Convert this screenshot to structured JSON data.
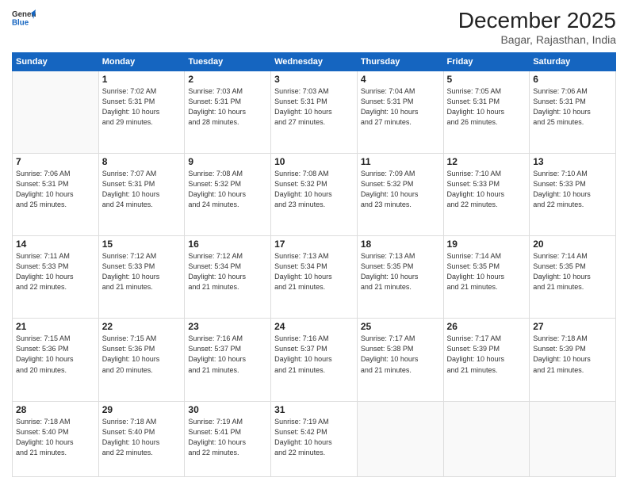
{
  "logo": {
    "line1": "General",
    "line2": "Blue"
  },
  "header": {
    "title": "December 2025",
    "subtitle": "Bagar, Rajasthan, India"
  },
  "days_of_week": [
    "Sunday",
    "Monday",
    "Tuesday",
    "Wednesday",
    "Thursday",
    "Friday",
    "Saturday"
  ],
  "weeks": [
    [
      {
        "day": "",
        "info": ""
      },
      {
        "day": "1",
        "info": "Sunrise: 7:02 AM\nSunset: 5:31 PM\nDaylight: 10 hours\nand 29 minutes."
      },
      {
        "day": "2",
        "info": "Sunrise: 7:03 AM\nSunset: 5:31 PM\nDaylight: 10 hours\nand 28 minutes."
      },
      {
        "day": "3",
        "info": "Sunrise: 7:03 AM\nSunset: 5:31 PM\nDaylight: 10 hours\nand 27 minutes."
      },
      {
        "day": "4",
        "info": "Sunrise: 7:04 AM\nSunset: 5:31 PM\nDaylight: 10 hours\nand 27 minutes."
      },
      {
        "day": "5",
        "info": "Sunrise: 7:05 AM\nSunset: 5:31 PM\nDaylight: 10 hours\nand 26 minutes."
      },
      {
        "day": "6",
        "info": "Sunrise: 7:06 AM\nSunset: 5:31 PM\nDaylight: 10 hours\nand 25 minutes."
      }
    ],
    [
      {
        "day": "7",
        "info": "Sunrise: 7:06 AM\nSunset: 5:31 PM\nDaylight: 10 hours\nand 25 minutes."
      },
      {
        "day": "8",
        "info": "Sunrise: 7:07 AM\nSunset: 5:31 PM\nDaylight: 10 hours\nand 24 minutes."
      },
      {
        "day": "9",
        "info": "Sunrise: 7:08 AM\nSunset: 5:32 PM\nDaylight: 10 hours\nand 24 minutes."
      },
      {
        "day": "10",
        "info": "Sunrise: 7:08 AM\nSunset: 5:32 PM\nDaylight: 10 hours\nand 23 minutes."
      },
      {
        "day": "11",
        "info": "Sunrise: 7:09 AM\nSunset: 5:32 PM\nDaylight: 10 hours\nand 23 minutes."
      },
      {
        "day": "12",
        "info": "Sunrise: 7:10 AM\nSunset: 5:33 PM\nDaylight: 10 hours\nand 22 minutes."
      },
      {
        "day": "13",
        "info": "Sunrise: 7:10 AM\nSunset: 5:33 PM\nDaylight: 10 hours\nand 22 minutes."
      }
    ],
    [
      {
        "day": "14",
        "info": "Sunrise: 7:11 AM\nSunset: 5:33 PM\nDaylight: 10 hours\nand 22 minutes."
      },
      {
        "day": "15",
        "info": "Sunrise: 7:12 AM\nSunset: 5:33 PM\nDaylight: 10 hours\nand 21 minutes."
      },
      {
        "day": "16",
        "info": "Sunrise: 7:12 AM\nSunset: 5:34 PM\nDaylight: 10 hours\nand 21 minutes."
      },
      {
        "day": "17",
        "info": "Sunrise: 7:13 AM\nSunset: 5:34 PM\nDaylight: 10 hours\nand 21 minutes."
      },
      {
        "day": "18",
        "info": "Sunrise: 7:13 AM\nSunset: 5:35 PM\nDaylight: 10 hours\nand 21 minutes."
      },
      {
        "day": "19",
        "info": "Sunrise: 7:14 AM\nSunset: 5:35 PM\nDaylight: 10 hours\nand 21 minutes."
      },
      {
        "day": "20",
        "info": "Sunrise: 7:14 AM\nSunset: 5:35 PM\nDaylight: 10 hours\nand 21 minutes."
      }
    ],
    [
      {
        "day": "21",
        "info": "Sunrise: 7:15 AM\nSunset: 5:36 PM\nDaylight: 10 hours\nand 20 minutes."
      },
      {
        "day": "22",
        "info": "Sunrise: 7:15 AM\nSunset: 5:36 PM\nDaylight: 10 hours\nand 20 minutes."
      },
      {
        "day": "23",
        "info": "Sunrise: 7:16 AM\nSunset: 5:37 PM\nDaylight: 10 hours\nand 21 minutes."
      },
      {
        "day": "24",
        "info": "Sunrise: 7:16 AM\nSunset: 5:37 PM\nDaylight: 10 hours\nand 21 minutes."
      },
      {
        "day": "25",
        "info": "Sunrise: 7:17 AM\nSunset: 5:38 PM\nDaylight: 10 hours\nand 21 minutes."
      },
      {
        "day": "26",
        "info": "Sunrise: 7:17 AM\nSunset: 5:39 PM\nDaylight: 10 hours\nand 21 minutes."
      },
      {
        "day": "27",
        "info": "Sunrise: 7:18 AM\nSunset: 5:39 PM\nDaylight: 10 hours\nand 21 minutes."
      }
    ],
    [
      {
        "day": "28",
        "info": "Sunrise: 7:18 AM\nSunset: 5:40 PM\nDaylight: 10 hours\nand 21 minutes."
      },
      {
        "day": "29",
        "info": "Sunrise: 7:18 AM\nSunset: 5:40 PM\nDaylight: 10 hours\nand 22 minutes."
      },
      {
        "day": "30",
        "info": "Sunrise: 7:19 AM\nSunset: 5:41 PM\nDaylight: 10 hours\nand 22 minutes."
      },
      {
        "day": "31",
        "info": "Sunrise: 7:19 AM\nSunset: 5:42 PM\nDaylight: 10 hours\nand 22 minutes."
      },
      {
        "day": "",
        "info": ""
      },
      {
        "day": "",
        "info": ""
      },
      {
        "day": "",
        "info": ""
      }
    ]
  ]
}
